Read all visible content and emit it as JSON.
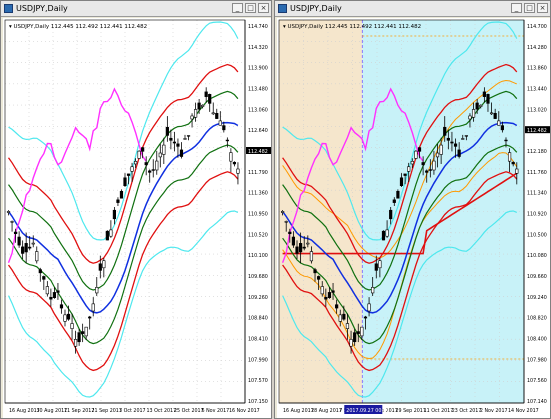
{
  "left_window": {
    "title": "USDJPY,Daily",
    "buttons": [
      "_",
      "□",
      "×"
    ],
    "ohlc": "▾ USDJPY,Daily  112.445 112.492 112.441 112.482",
    "price_labels": [
      "114.740",
      "114.320",
      "113.900",
      "113.480",
      "113.060",
      "112.640",
      "112.482",
      "111.790",
      "111.360",
      "110.950",
      "110.520",
      "110.100",
      "109.680",
      "109.260",
      "108.840",
      "108.410",
      "107.990",
      "107.570",
      "107.150"
    ],
    "current_price": "112.482",
    "date_labels": [
      "16 Aug 2017",
      "30 Aug 2017",
      "11 Sep 2017",
      "21 Sep 2017",
      "3 Oct 2017",
      "13 Oct 2017",
      "25 Oct 2017",
      "6 Nov 2017",
      "16 Nov 2017"
    ]
  },
  "right_window": {
    "title": "USDJPY,Daily",
    "buttons": [
      "_",
      "□",
      "×"
    ],
    "ohlc": "▾ USDJPY,Daily  112.445 112.492 112.441 112.482",
    "price_labels": [
      "114.700",
      "114.280",
      "113.860",
      "113.440",
      "113.020",
      "112.482",
      "112.180",
      "111.760",
      "111.340",
      "110.920",
      "110.500",
      "110.080",
      "109.660",
      "109.240",
      "108.820",
      "108.400",
      "107.980",
      "107.560",
      "107.140"
    ],
    "current_price": "112.482",
    "date_labels": [
      "16 Aug 2017",
      "28 Aug 2017",
      "7 Sep 2017",
      "19 Sep 2017",
      "29 Sep 2017",
      "11 Oct 2017",
      "23 Oct 2017",
      "2 Nov 2017",
      "14 Nov 2017"
    ],
    "highlight_date": "2017.09.27 00:00"
  },
  "colors": {
    "candles": "#000000",
    "bollinger_outer": "#4ee8ee",
    "bollinger_mid_red": "#e01010",
    "bollinger_inner": "#107010",
    "ma_blue": "#1030e0",
    "lagging_span": "#ff30ff",
    "cloud_border": "#ff9a00",
    "cloud_fill_right": "#c8f2f8",
    "cloud_fill_left": "#f5e6cc"
  }
}
